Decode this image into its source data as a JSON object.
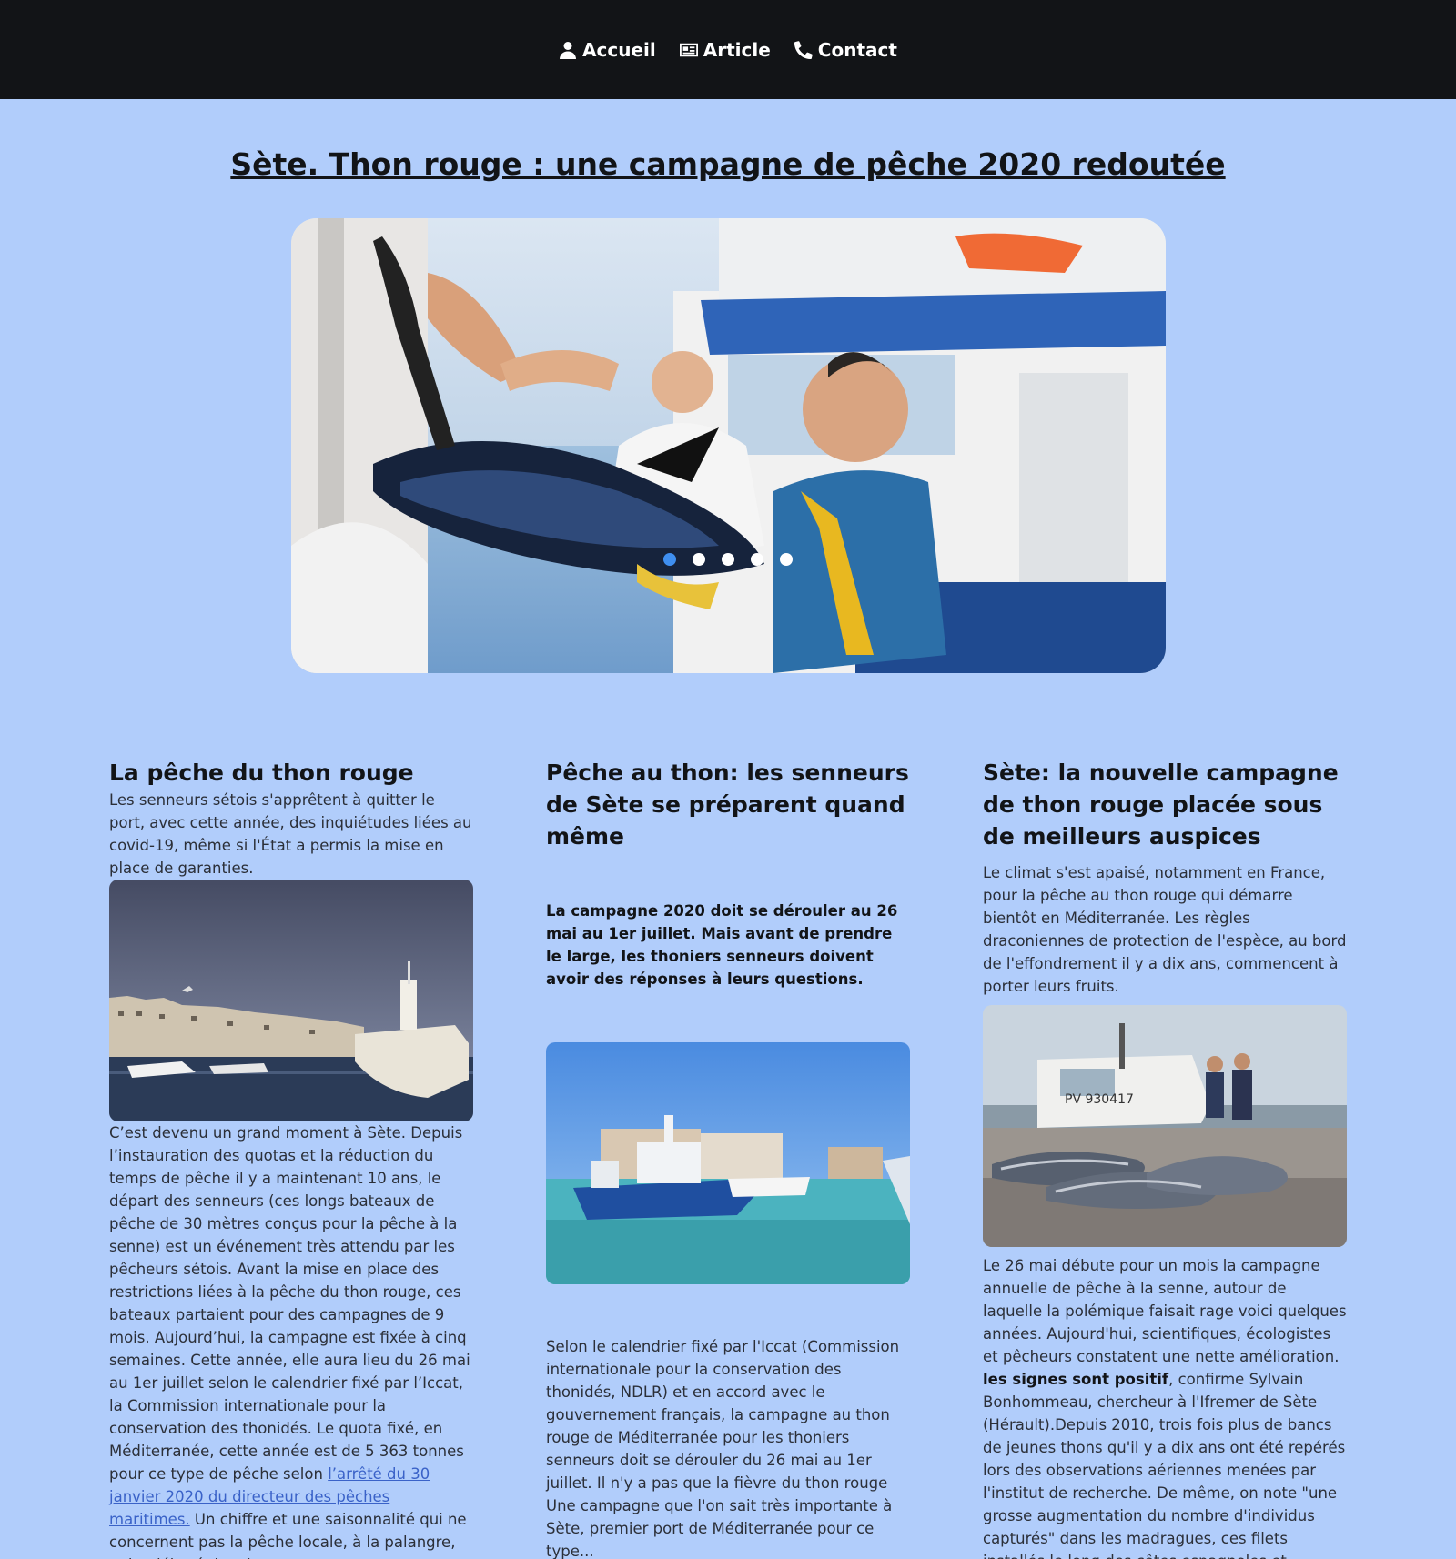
{
  "nav": {
    "items": [
      {
        "label": "Accueil",
        "icon": "user-icon"
      },
      {
        "label": "Article",
        "icon": "newspaper-icon"
      },
      {
        "label": "Contact",
        "icon": "phone-icon"
      }
    ]
  },
  "title": "Sète. Thon rouge : une campagne de pêche 2020 redoutée",
  "carousel": {
    "slide_count": 5,
    "active_slide": 1,
    "active_color": "#3f8ff0"
  },
  "columns": [
    {
      "heading": "La pêche du thon rouge",
      "intro": "Les senneurs sétois s'apprêtent à quitter le port, avec cette année, des inquiétudes liées au covid-19, même si l'État a permis la mise en place de garanties.",
      "body_start": "C’est devenu un grand moment à Sète. Depuis l’instauration des quotas et la réduction du temps de pêche il y a maintenant 10 ans, le départ des senneurs (ces longs bateaux de pêche de 30 mètres conçus pour la pêche à la senne) est un événement très attendu par les pêcheurs sétois. Avant la mise en place des restrictions liées à la pêche du thon rouge, ces bateaux partaient pour des campagnes de 9 mois. Aujourd’hui, la campagne est fixée à cinq semaines. Cette année, elle aura lieu du 26 mai au 1er juillet selon le calendrier fixé par l’Iccat, la Commission internationale pour la conservation des thonidés. Le quota fixé, en Méditerranée, cette année est de 5 363 tonnes pour ce type de pêche selon ",
      "link": "l’arrêté du 30 janvier 2020 du directeur des pêches maritimes.",
      "body_end": " Un chiffre et une saisonnalité qui ne concernent pas la pêche locale, à la palangre, qui a débuté depuis mars."
    },
    {
      "heading": "Pêche au thon: les senneurs de Sète se préparent quand même",
      "lead": "La campagne 2020 doit se dérouler au 26 mai au 1er juillet. Mais avant de prendre le large, les thoniers senneurs doivent avoir des réponses à leurs questions.",
      "body": "Selon le calendrier fixé par l'Iccat (Commission internationale pour la conservation des thonidés, NDLR) et en accord avec le gouvernement français, la campagne au thon rouge de Méditerranée pour les thoniers senneurs doit se dérouler du 26 mai au 1er juillet. Il n'y a pas que la fièvre du thon rouge Une campagne que l'on sait très importante à Sète, premier port de Méditerranée pour ce type..."
    },
    {
      "heading": "Sète: la nouvelle campagne de thon rouge placée sous de meilleurs auspices",
      "intro": "Le climat s'est apaisé, notamment en France, pour la pêche au thon rouge qui démarre bientôt en Méditerranée. Les règles draconiennes de protection de l'espèce, au bord de l'effondrement il y a dix ans, commencent à porter leurs fruits.",
      "body_start": "Le 26 mai débute pour un mois la campagne annuelle de pêche à la senne, autour de laquelle la polémique faisait rage voici quelques années. Aujourd'hui, scientifiques, écologistes et pêcheurs constatent une nette amélioration. ",
      "bold": "les signes sont positif",
      "body_end": ", confirme Sylvain Bonhommeau, chercheur à l'Ifremer de Sète (Hérault).Depuis 2010, trois fois plus de bancs de jeunes thons qu'il y a dix ans ont été repérés lors des observations aériennes menées par l'institut de recherche. De même, on note \"une grosse augmentation du nombre d'individus capturés\" dans les madragues, ces filets installés le long des côtes espagnoles et marocaines.",
      "boat_label": "PV 930417"
    }
  ]
}
